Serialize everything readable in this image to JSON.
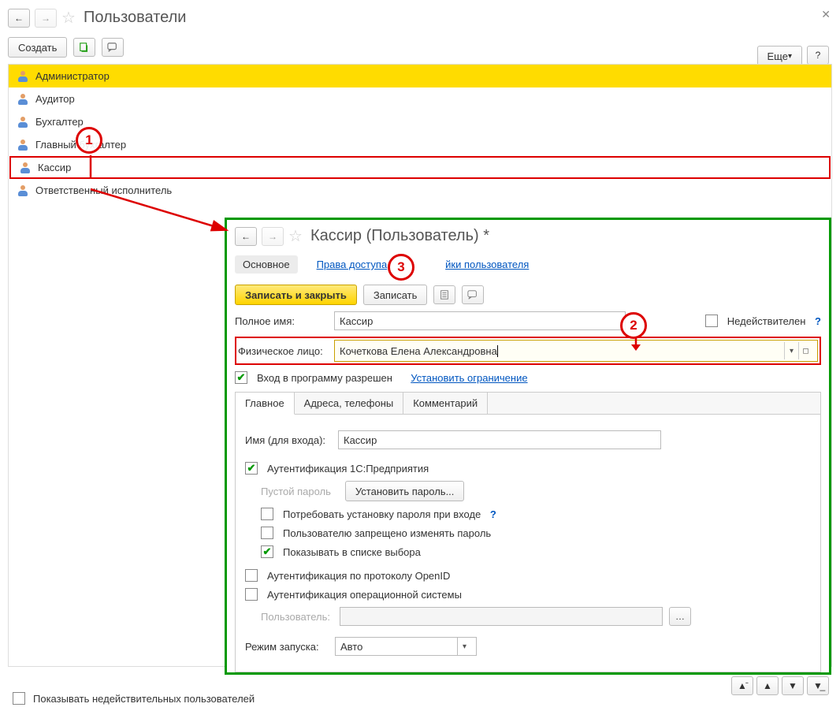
{
  "header": {
    "title": "Пользователи"
  },
  "toolbar": {
    "create": "Создать",
    "more": "Еще",
    "help": "?"
  },
  "users": [
    "Администратор",
    "Аудитор",
    "Бухгалтер",
    "Главный бухгалтер",
    "Кассир",
    "Ответственный исполнитель"
  ],
  "callouts": {
    "c1": "1",
    "c2": "2",
    "c3": "3"
  },
  "inner": {
    "title": "Кассир (Пользователь) *",
    "tabs": {
      "main": "Основное",
      "rights": "Права доступа",
      "settings": "йки пользователя"
    },
    "buttons": {
      "save_close": "Записать и закрыть",
      "save": "Записать"
    },
    "full_name_lbl": "Полное имя:",
    "full_name_val": "Кассир",
    "invalid_lbl": "Недействителен",
    "person_lbl": "Физическое лицо:",
    "person_val": "Кочеткова Елена Александровна",
    "login_allowed": "Вход в программу разрешен",
    "set_limit": "Установить ограничение",
    "sub_tabs": {
      "main": "Главное",
      "addr": "Адреса, телефоны",
      "comment": "Комментарий"
    },
    "login_lbl": "Имя (для входа):",
    "login_val": "Кассир",
    "auth_1c": "Аутентификация 1С:Предприятия",
    "empty_pass": "Пустой пароль",
    "set_pass": "Установить пароль...",
    "require_change": "Потребовать установку пароля при входе",
    "no_pw_change": "Пользователю запрещено изменять пароль",
    "show_in_list": "Показывать в списке выбора",
    "auth_openid": "Аутентификация по протоколу OpenID",
    "auth_os": "Аутентификация операционной системы",
    "os_user_lbl": "Пользователь:",
    "launch_mode_lbl": "Режим запуска:",
    "launch_mode_val": "Авто"
  },
  "footer": {
    "show_invalid": "Показывать недействительных пользователей"
  }
}
